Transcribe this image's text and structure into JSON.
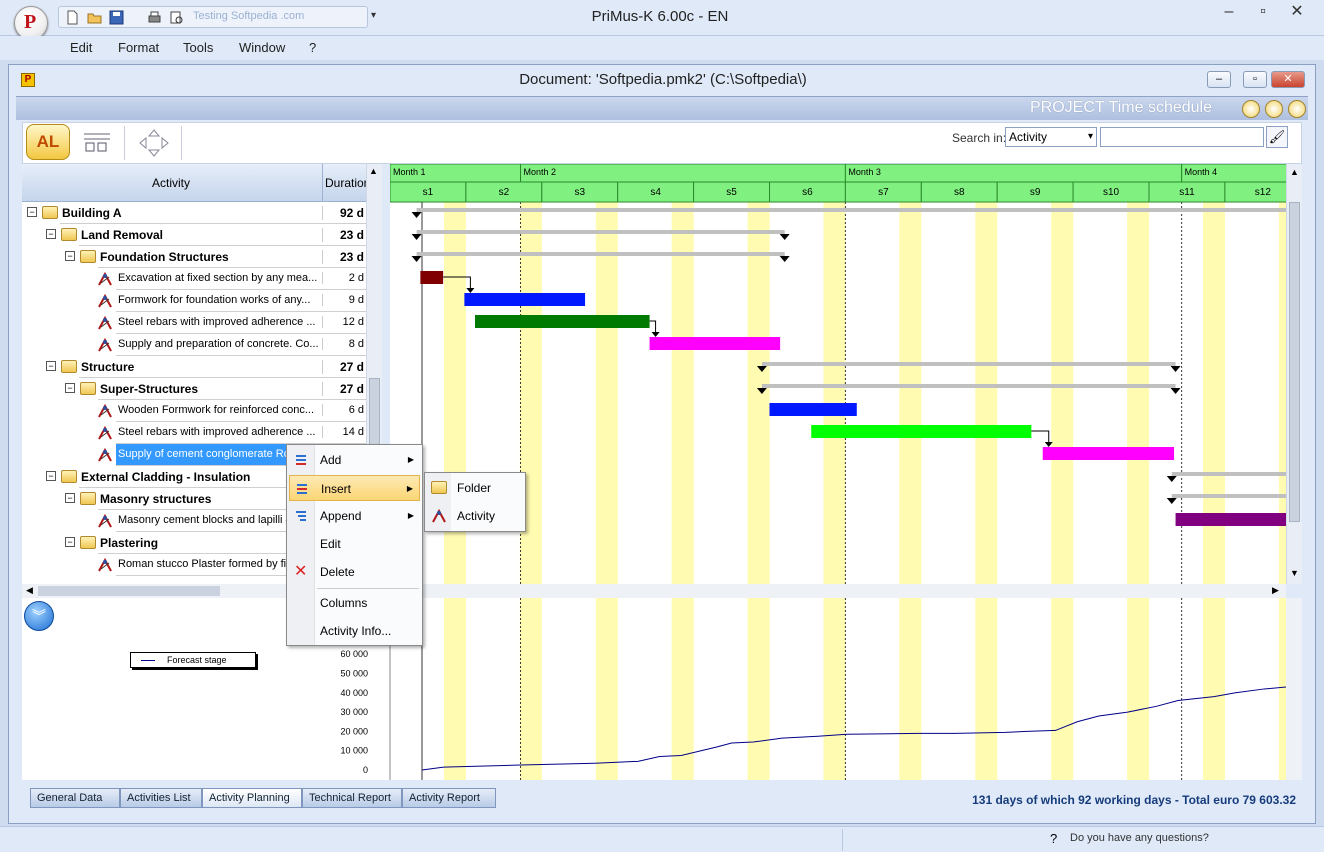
{
  "app": {
    "title": "PriMus-K    6.00c - EN",
    "qat_text": "Testing Softpedia .com",
    "menu": [
      "Edit",
      "Format",
      "Tools",
      "Window",
      "?"
    ]
  },
  "document": {
    "title": "Document: 'Softpedia.pmk2'    (C:\\Softpedia\\)",
    "section_title": "PROJECT Time schedule"
  },
  "toolbar": {
    "al_label": "AL",
    "search_label": "Search in:",
    "search_option": "Activity",
    "search_value": ""
  },
  "tree": {
    "col_activity": "Activity",
    "col_duration": "Duration",
    "rows": [
      {
        "level": 0,
        "type": "folder",
        "name": "Building A",
        "duration": "92 d",
        "bold": true
      },
      {
        "level": 1,
        "type": "folder",
        "name": "Land Removal",
        "duration": "23 d",
        "bold": true
      },
      {
        "level": 2,
        "type": "folder",
        "name": "Foundation Structures",
        "duration": "23 d",
        "bold": true
      },
      {
        "level": 3,
        "type": "activity",
        "name": "Excavation at fixed section by any mea...",
        "duration": "2 d",
        "bold": false
      },
      {
        "level": 3,
        "type": "activity",
        "name": "Formwork for foundation works of any...",
        "duration": "9 d",
        "bold": false
      },
      {
        "level": 3,
        "type": "activity",
        "name": "Steel rebars with improved adherence ...",
        "duration": "12 d",
        "bold": false
      },
      {
        "level": 3,
        "type": "activity",
        "name": "Supply and preparation of concrete. Co...",
        "duration": "8 d",
        "bold": false
      },
      {
        "level": 1,
        "type": "folder",
        "name": "Structure",
        "duration": "27 d",
        "bold": true
      },
      {
        "level": 2,
        "type": "folder",
        "name": "Super-Structures",
        "duration": "27 d",
        "bold": true
      },
      {
        "level": 3,
        "type": "activity",
        "name": "Wooden Formwork for reinforced conc...",
        "duration": "6 d",
        "bold": false
      },
      {
        "level": 3,
        "type": "activity",
        "name": "Steel rebars with improved adherence ...",
        "duration": "14 d",
        "bold": false
      },
      {
        "level": 3,
        "type": "activity",
        "name": "Supply of cement conglomerate Rck...",
        "duration": "",
        "bold": false,
        "selected": true
      },
      {
        "level": 1,
        "type": "folder",
        "name": "External Cladding - Insulation",
        "duration": "",
        "bold": true
      },
      {
        "level": 2,
        "type": "folder",
        "name": "Masonry structures",
        "duration": "",
        "bold": true
      },
      {
        "level": 3,
        "type": "activity",
        "name": "Masonry cement blocks and lapilli 4...",
        "duration": "",
        "bold": false
      },
      {
        "level": 2,
        "type": "folder",
        "name": "Plastering",
        "duration": "",
        "bold": true
      },
      {
        "level": 3,
        "type": "activity",
        "name": "Roman stucco Plaster formed by fi...",
        "duration": "",
        "bold": false
      }
    ]
  },
  "timeline": {
    "months": [
      "Month 1",
      "Month 2",
      "Month 3",
      "Month 4"
    ],
    "weeks": [
      "s1",
      "s2",
      "s3",
      "s4",
      "s5",
      "s6",
      "s7",
      "s8",
      "s9",
      "s10",
      "s11",
      "s12"
    ],
    "bars": [
      {
        "row": 0,
        "start": 0.35,
        "end": 12.0,
        "color": "#c0c0c0",
        "summary": true
      },
      {
        "row": 1,
        "start": 0.35,
        "end": 5.2,
        "color": "#c0c0c0",
        "summary": true
      },
      {
        "row": 2,
        "start": 0.35,
        "end": 5.2,
        "color": "#c0c0c0",
        "summary": true
      },
      {
        "row": 3,
        "start": 0.4,
        "end": 0.7,
        "color": "#800000"
      },
      {
        "row": 4,
        "start": 0.98,
        "end": 2.57,
        "color": "#0018ff"
      },
      {
        "row": 5,
        "start": 1.12,
        "end": 3.42,
        "color": "#007a00"
      },
      {
        "row": 6,
        "start": 3.42,
        "end": 5.14,
        "color": "#ff00ff"
      },
      {
        "row": 7,
        "start": 4.9,
        "end": 10.35,
        "color": "#c0c0c0",
        "summary": true
      },
      {
        "row": 8,
        "start": 4.9,
        "end": 10.35,
        "color": "#c0c0c0",
        "summary": true
      },
      {
        "row": 9,
        "start": 5.0,
        "end": 6.15,
        "color": "#0018ff"
      },
      {
        "row": 10,
        "start": 5.55,
        "end": 8.45,
        "color": "#00ff00"
      },
      {
        "row": 11,
        "start": 8.6,
        "end": 10.33,
        "color": "#ff00ff"
      },
      {
        "row": 12,
        "start": 10.3,
        "end": 12.0,
        "color": "#c0c0c0",
        "summary": true
      },
      {
        "row": 13,
        "start": 10.3,
        "end": 12.0,
        "color": "#c0c0c0",
        "summary": true
      },
      {
        "row": 14,
        "start": 10.35,
        "end": 12.0,
        "color": "#800080"
      }
    ]
  },
  "lower_chart": {
    "legend": "Forecast stage",
    "yticks": [
      "60 000",
      "50 000",
      "40 000",
      "30 000",
      "20 000",
      "10 000",
      "0"
    ],
    "curve": [
      [
        0,
        0
      ],
      [
        0.3,
        1500
      ],
      [
        1.3,
        2500
      ],
      [
        2.4,
        3500
      ],
      [
        3.0,
        4500
      ],
      [
        3.3,
        7000
      ],
      [
        3.6,
        7500
      ],
      [
        4.1,
        12000
      ],
      [
        4.3,
        14000
      ],
      [
        4.6,
        14500
      ],
      [
        5.0,
        16500
      ],
      [
        5.5,
        17500
      ],
      [
        5.9,
        18500
      ],
      [
        6.9,
        19000
      ],
      [
        7.4,
        19000
      ],
      [
        8.1,
        19500
      ],
      [
        8.4,
        20000
      ],
      [
        8.8,
        20500
      ],
      [
        9.1,
        25000
      ],
      [
        9.4,
        28000
      ],
      [
        9.8,
        30000
      ],
      [
        10.2,
        33000
      ],
      [
        10.5,
        36000
      ],
      [
        11.0,
        38000
      ],
      [
        11.3,
        40000
      ],
      [
        11.7,
        42000
      ],
      [
        12.0,
        43000
      ]
    ]
  },
  "context_menu": {
    "items": [
      {
        "label": "Add",
        "submenu": true
      },
      {
        "label": "Insert",
        "submenu": true,
        "highlighted": true
      },
      {
        "label": "Append",
        "submenu": true
      },
      {
        "label": "Edit",
        "submenu": false
      },
      {
        "label": "Delete",
        "submenu": false
      },
      {
        "label": "Columns",
        "submenu": false
      },
      {
        "label": "Activity Info...",
        "submenu": false
      }
    ],
    "submenu": [
      "Folder",
      "Activity"
    ]
  },
  "tabs": [
    "General Data",
    "Activities List",
    "Activity Planning",
    "Technical Report",
    "Activity Report"
  ],
  "status": {
    "total": "131 days of which 92 working days - Total euro 79 603.32",
    "help": "Do you have any questions?"
  },
  "colors": {
    "timeline_head": "#80f080",
    "weekend": "#fffbb0",
    "selection": "#3399ff"
  }
}
